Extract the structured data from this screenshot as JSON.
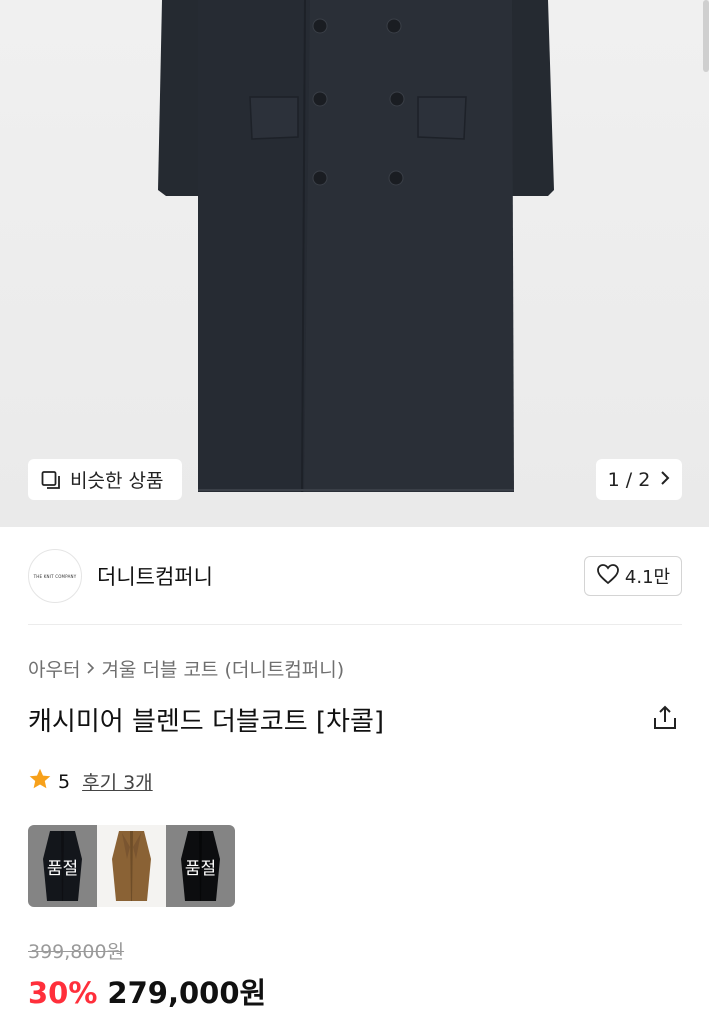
{
  "hero": {
    "similar_label": "비슷한 상품",
    "pager": {
      "current": "1",
      "separator": "/",
      "total": "2"
    }
  },
  "brand": {
    "logo_text": "THE KNIT COMPANY",
    "name": "더니트컴퍼니",
    "likes": "4.1만"
  },
  "breadcrumb": {
    "category": "아우터",
    "subcategory": "겨울 더블 코트 (더니트컴퍼니)"
  },
  "product": {
    "title": "캐시미어 블렌드 더블코트 [차콜]",
    "rating": "5",
    "reviews": "후기 3개"
  },
  "colors": [
    {
      "name": "navy",
      "sold_out_label": "품절"
    },
    {
      "name": "camel",
      "sold_out_label": ""
    },
    {
      "name": "black",
      "sold_out_label": "품절"
    }
  ],
  "price": {
    "original": "399,800원",
    "discount": "30%",
    "final": "279,000원"
  },
  "theme": {
    "accent_red": "#ff2f3b",
    "star": "#f7a11b"
  }
}
